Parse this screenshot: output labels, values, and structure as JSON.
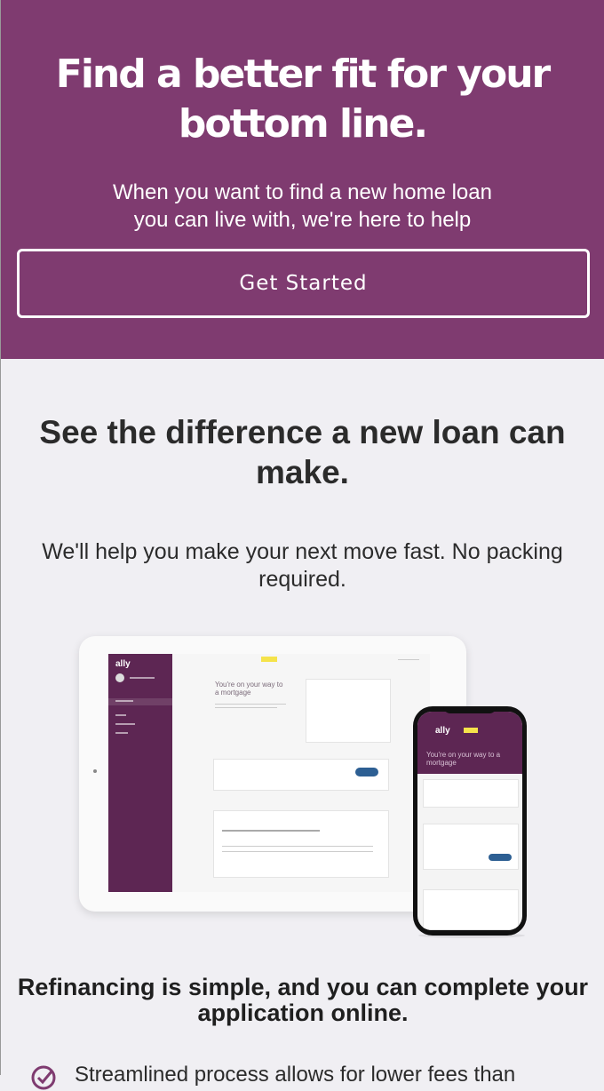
{
  "hero": {
    "title": "Find a better fit for your bottom line.",
    "subtitle": "When you want to find a new home loan you can live with, we're here to help",
    "cta_label": "Get Started"
  },
  "difference": {
    "heading": "See the difference a new loan can make.",
    "subtext": "We'll help you make your next move fast. No packing required."
  },
  "illustration": {
    "tablet_logo": "ally",
    "tablet_title": "You're on your way to a mortgage",
    "phone_logo": "ally",
    "phone_title": "You're on your way to a mortgage"
  },
  "refinance": {
    "heading": "Refinancing is simple, and you can complete your application online.",
    "bullets": [
      "Streamlined process allows for lower fees than"
    ]
  },
  "colors": {
    "brand_purple": "#7f3b70",
    "sidebar_purple": "#5d2653",
    "page_bg": "#f0eff3"
  }
}
